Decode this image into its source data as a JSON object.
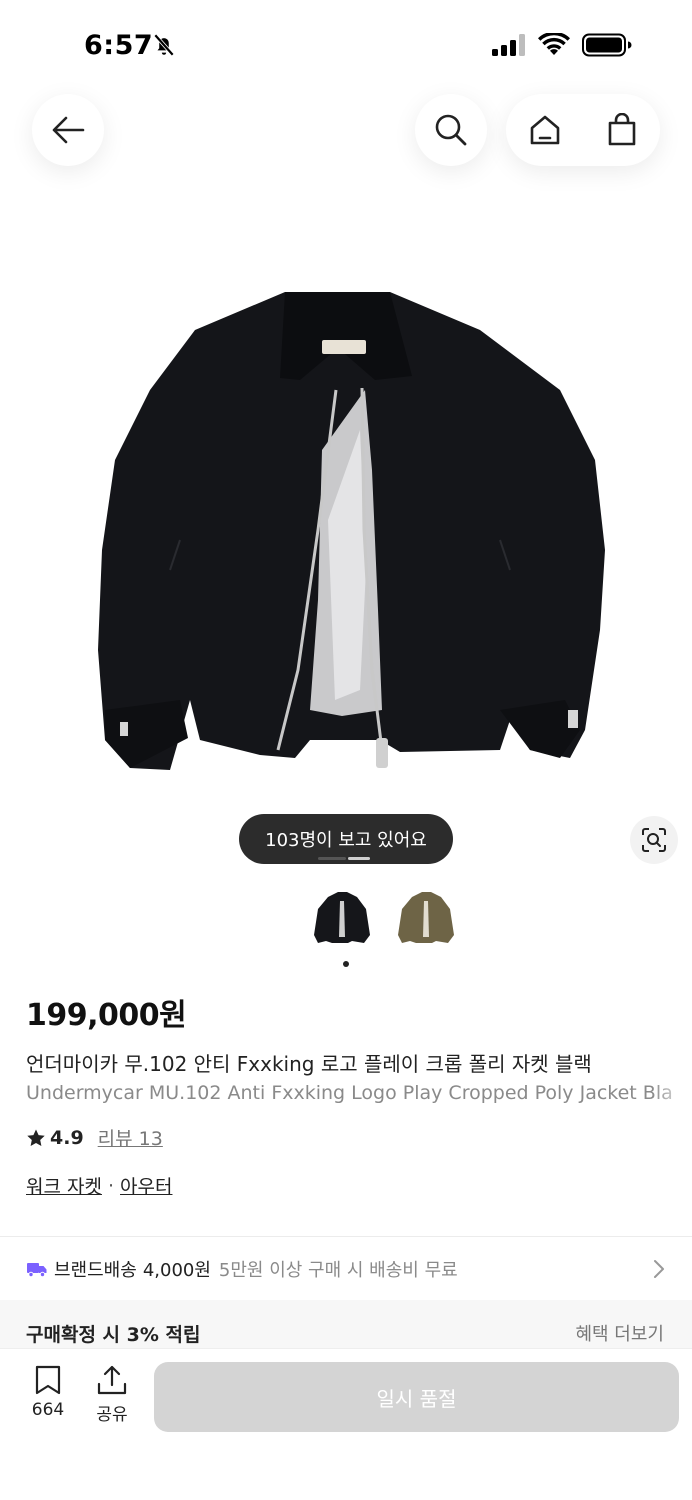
{
  "status_bar": {
    "time": "6:57"
  },
  "product": {
    "viewers_text": "103명이 보고 있어요",
    "price": "199,000원",
    "title_ko": "언더마이카 무.102 안티 Fxxking 로고 플레이 크롭 폴리 자켓 블랙",
    "title_en": "Undermycar MU.102 Anti Fxxking Logo Play Cropped Poly Jacket Bla",
    "rating": "4.9",
    "reviews": "리뷰 13",
    "category": [
      "워크 자켓",
      "아우터"
    ],
    "category_sep": "·"
  },
  "shipping": {
    "label": "브랜드배송",
    "fee": "4,000원",
    "note": "5만원 이상 구매 시 배송비 무료"
  },
  "benefit": {
    "text": "구매확정 시 3% 적립",
    "more": "혜택 더보기"
  },
  "bottom_bar": {
    "like_count": "664",
    "share_label": "공유",
    "soldout_label": "일시 품절"
  },
  "colors": {
    "accent_purple": "#7b61ff",
    "disabled_button": "#d4d4d4",
    "pill_bg": "#2c2c2c"
  },
  "icons": [
    "back-arrow-icon",
    "search-icon",
    "home-icon",
    "shopping-bag-icon",
    "bell-off-icon",
    "lens-search-icon",
    "star-icon",
    "truck-icon",
    "chevron-right-icon",
    "bookmark-icon",
    "share-icon"
  ]
}
